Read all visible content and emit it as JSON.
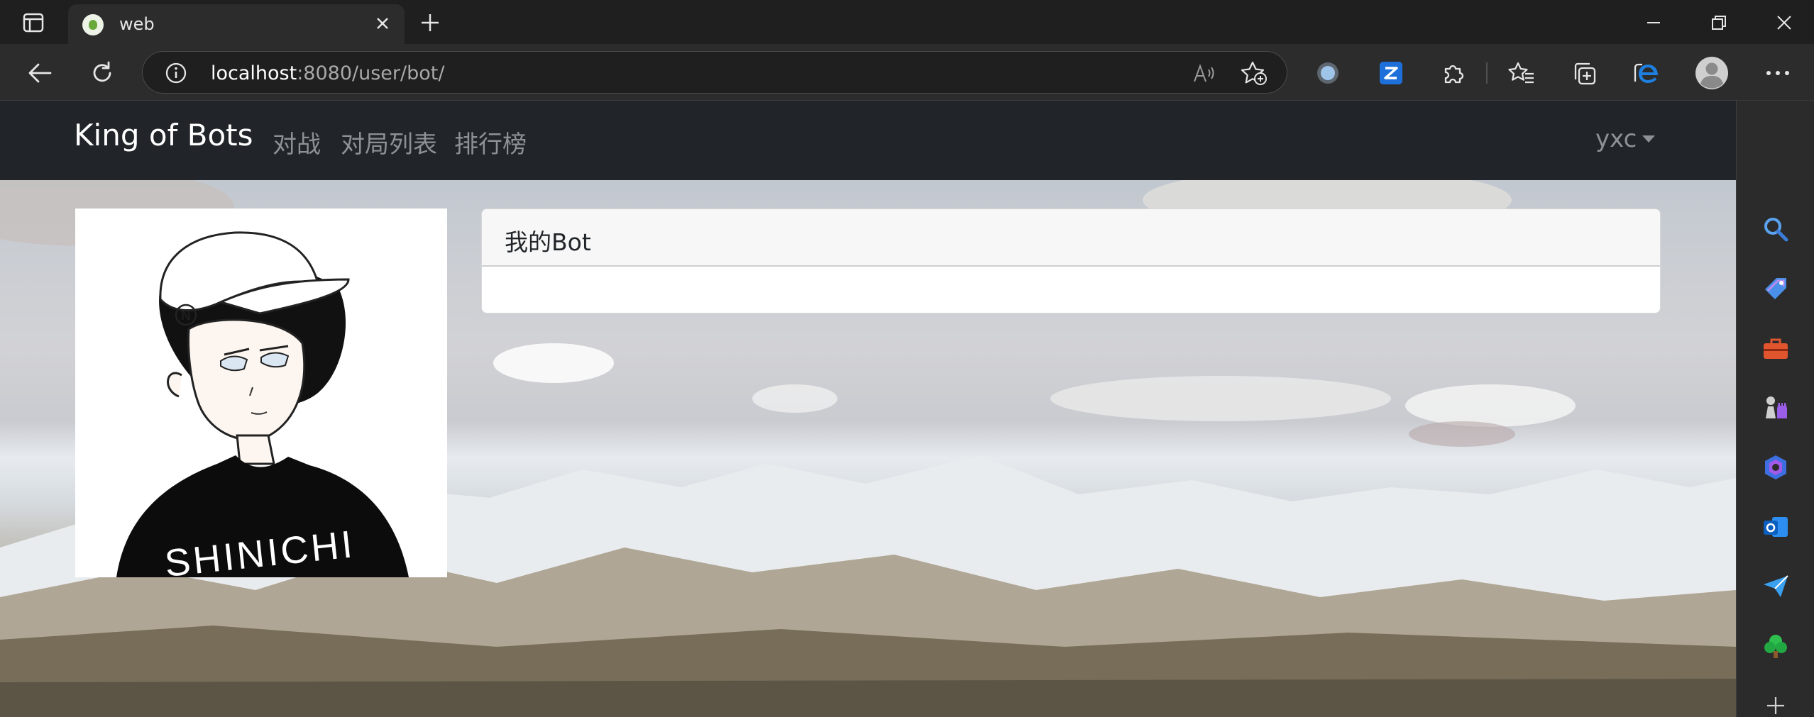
{
  "browser": {
    "tab": {
      "title": "web"
    },
    "address": {
      "host": "localhost",
      "path": ":8080/user/bot/"
    }
  },
  "icons": {
    "tab_strip": [
      "tab-actions-icon",
      "close-icon",
      "plus-icon",
      "minimize-icon",
      "restore-icon",
      "window-close-icon"
    ],
    "toolbar": [
      "back-icon",
      "refresh-icon",
      "info-icon",
      "read-aloud-icon",
      "add-favorite-icon",
      "circle-extension-icon",
      "z-extension-icon",
      "extensions-puzzle-icon",
      "favorites-icon",
      "collections-icon",
      "edge-browser-icon",
      "profile-icon",
      "more-icon"
    ],
    "sidebar": [
      "search-icon",
      "tag-icon",
      "toolbox-icon",
      "chess-icon",
      "copilot-icon",
      "outlook-icon",
      "send-icon",
      "tree-icon",
      "plus-icon"
    ]
  },
  "site": {
    "brand": "King of Bots",
    "nav": [
      "对战",
      "对局列表",
      "排行榜"
    ],
    "user": "yxc"
  },
  "card": {
    "title": "我的Bot"
  },
  "avatar": {
    "shirt_text": "SHINICHI",
    "cap_letter": "N"
  },
  "colors": {
    "navbar": "#212529",
    "nav_link": "#8d9196",
    "card_header": "#f7f7f7",
    "browser_frame": "#1f1f1f",
    "edge_accent": "#1e7fe0"
  }
}
